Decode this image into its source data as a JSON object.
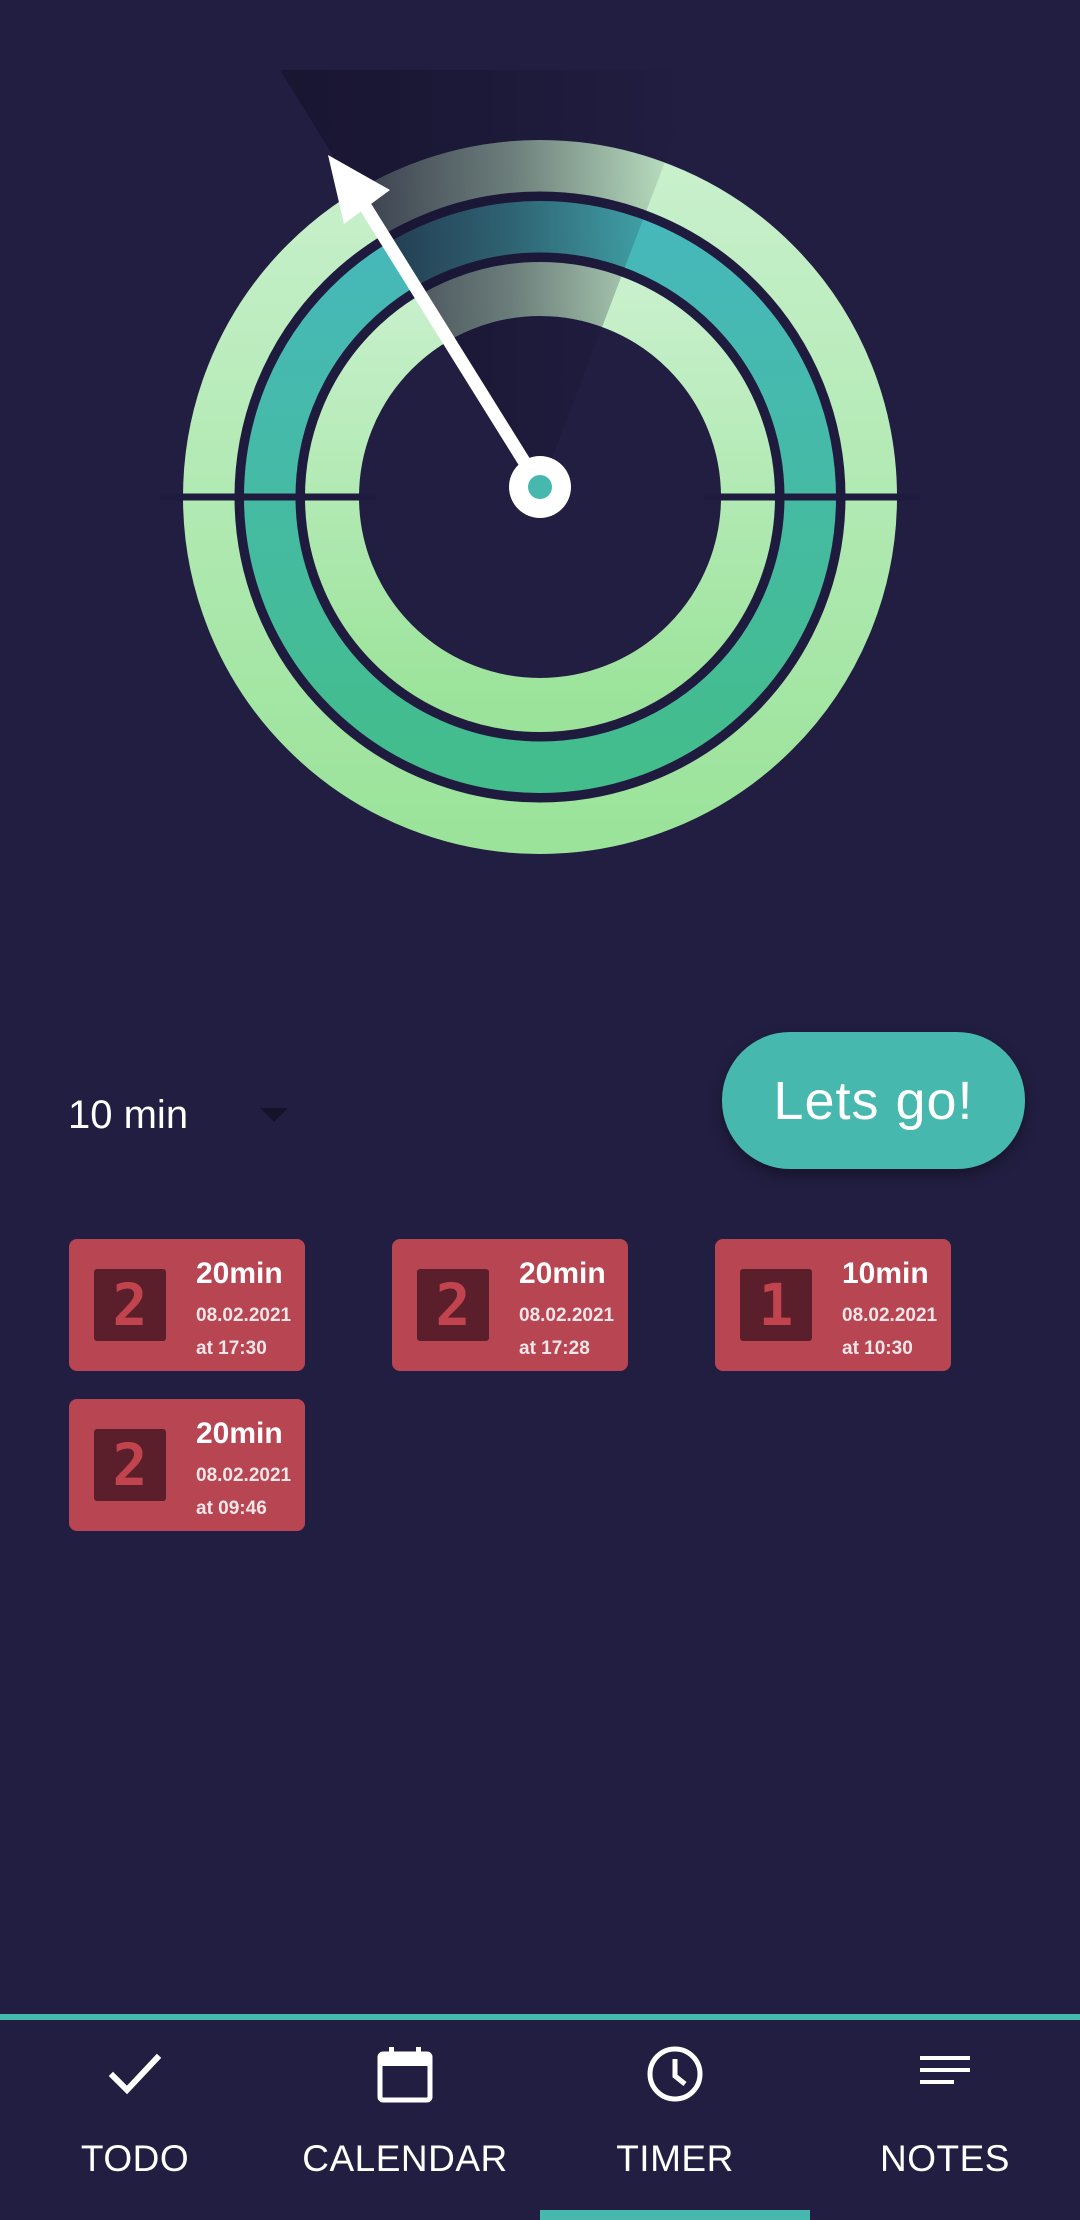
{
  "app": {
    "accent_color": "#47b8ad",
    "background_color": "#221e42",
    "card_color": "#b84652"
  },
  "dial": {
    "center_icon": "dial-pivot-icon",
    "pointer_icon": "arrow-pointer-icon"
  },
  "timer": {
    "selected_duration": "10 min",
    "start_label": "Lets go!"
  },
  "sessions": [
    {
      "count": "2",
      "duration": "20min",
      "date": "08.02.2021",
      "time": "at 17:30"
    },
    {
      "count": "2",
      "duration": "20min",
      "date": "08.02.2021",
      "time": "at 17:28"
    },
    {
      "count": "1",
      "duration": "10min",
      "date": "08.02.2021",
      "time": "at 10:30"
    },
    {
      "count": "2",
      "duration": "20min",
      "date": "08.02.2021",
      "time": "at 09:46"
    }
  ],
  "nav": {
    "active": "TIMER",
    "items": [
      {
        "label": "TODO",
        "icon": "check-icon"
      },
      {
        "label": "CALENDAR",
        "icon": "calendar-icon"
      },
      {
        "label": "TIMER",
        "icon": "clock-icon"
      },
      {
        "label": "NOTES",
        "icon": "notes-icon"
      }
    ]
  }
}
